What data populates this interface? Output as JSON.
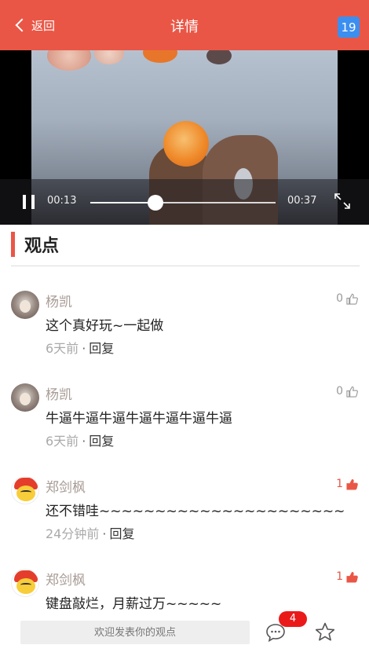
{
  "header": {
    "back_label": "返回",
    "title": "详情",
    "count_badge": "19",
    "color": "#ea5646"
  },
  "video": {
    "current_time": "00:13",
    "duration": "00:37",
    "progress": 0.35,
    "state": "playing"
  },
  "section": {
    "title": "观点"
  },
  "comments": [
    {
      "name": "杨凯",
      "text": "这个真好玩~一起做",
      "time": "6天前",
      "reply": "回复",
      "likes": "0",
      "liked": false,
      "avatar": "photo"
    },
    {
      "name": "杨凯",
      "text": "牛逼牛逼牛逼牛逼牛逼牛逼牛逼",
      "time": "6天前",
      "reply": "回复",
      "likes": "0",
      "liked": false,
      "avatar": "photo"
    },
    {
      "name": "郑剑枫",
      "text": "还不错哇~~~~~~~~~~~~~~~~~~~~~~",
      "time": "24分钟前",
      "reply": "回复",
      "likes": "1",
      "liked": true,
      "avatar": "cartoon"
    },
    {
      "name": "郑剑枫",
      "text": "键盘敲烂，月薪过万~~~~~",
      "time": "",
      "reply": "",
      "likes": "1",
      "liked": true,
      "avatar": "cartoon"
    }
  ],
  "bottom": {
    "input_placeholder": "欢迎发表你的观点",
    "comment_count": "4"
  },
  "colors": {
    "accent": "#ea5646",
    "badge_blue": "#3b8ff0",
    "badge_red": "#ea1a1a"
  }
}
